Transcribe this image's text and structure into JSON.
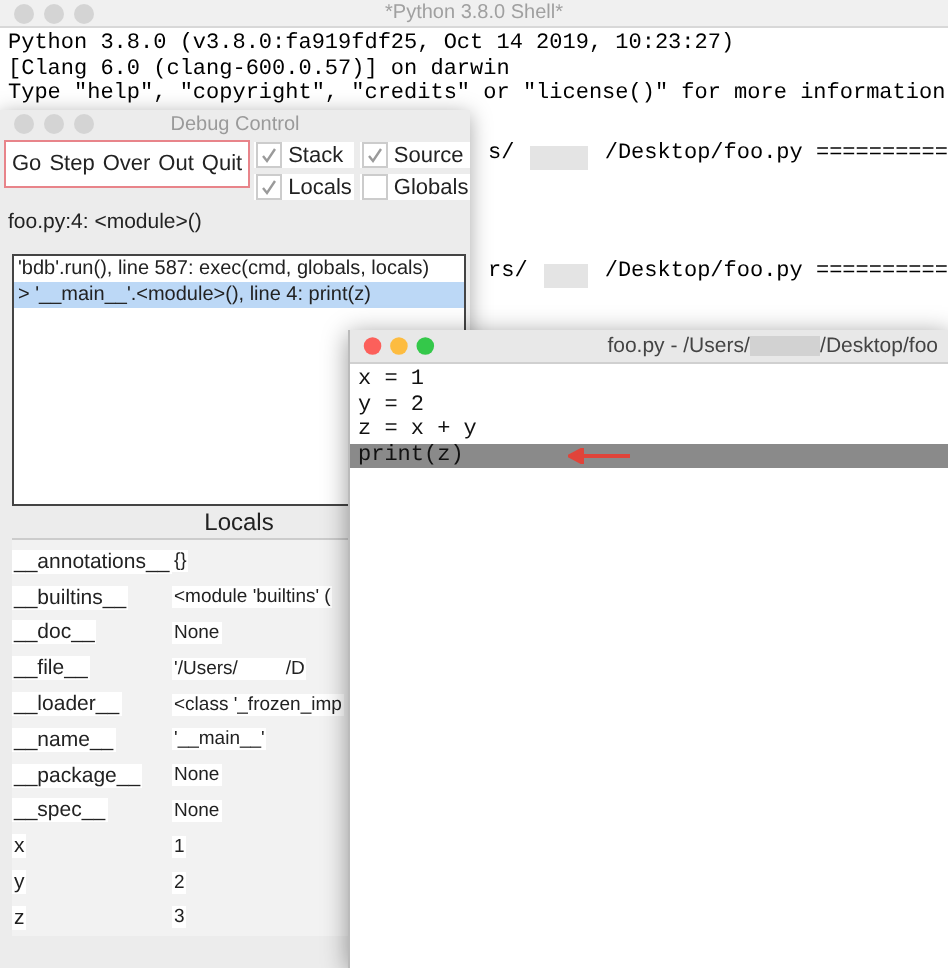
{
  "shell": {
    "title": "*Python 3.8.0 Shell*",
    "lines": [
      "Python 3.8.0 (v3.8.0:fa919fdf25, Oct 14 2019, 10:23:27)",
      "[Clang 6.0 (clang-600.0.57)] on darwin",
      "Type \"help\", \"copyright\", \"credits\" or \"license()\" for more information"
    ],
    "restart_lines": [
      {
        "before": "s/",
        "after": "/Desktop/foo.py =========="
      },
      {
        "before": "rs/",
        "after": "/Desktop/foo.py =========="
      }
    ]
  },
  "debug": {
    "title": "Debug Control",
    "buttons": [
      "Go",
      "Step",
      "Over",
      "Out",
      "Quit"
    ],
    "options": [
      {
        "label": "Stack",
        "checked": true
      },
      {
        "label": "Source",
        "checked": true
      },
      {
        "label": "Locals",
        "checked": true
      },
      {
        "label": "Globals",
        "checked": false
      }
    ],
    "status": "foo.py:4: <module>()",
    "stack": [
      {
        "text": "'bdb'.run(), line 587: exec(cmd, globals, locals)",
        "selected": false
      },
      {
        "text": "> '__main__'.<module>(), line 4: print(z)",
        "selected": true
      }
    ],
    "locals_title": "Locals",
    "locals": [
      {
        "name": "__annotations__",
        "value": "{}"
      },
      {
        "name": "__builtins__",
        "value": "<module 'builtins' ("
      },
      {
        "name": "__doc__",
        "value": "None"
      },
      {
        "name": "__file__",
        "value": "'/Users/",
        "value_tail": "/D"
      },
      {
        "name": "__loader__",
        "value": "<class '_frozen_imp"
      },
      {
        "name": "__name__",
        "value": "'__main__'"
      },
      {
        "name": "__package__",
        "value": "None"
      },
      {
        "name": "__spec__",
        "value": "None"
      },
      {
        "name": "x",
        "value": "1"
      },
      {
        "name": "y",
        "value": "2"
      },
      {
        "name": "z",
        "value": "3"
      }
    ]
  },
  "editor": {
    "title": "foo.py - /Users/",
    "title_tail": "/Desktop/foo",
    "lines": [
      {
        "text": "x = 1",
        "current": false
      },
      {
        "text": "y = 2",
        "current": false
      },
      {
        "text": "z = x + y",
        "current": false
      },
      {
        "text": "print(z)",
        "current": true
      }
    ]
  }
}
